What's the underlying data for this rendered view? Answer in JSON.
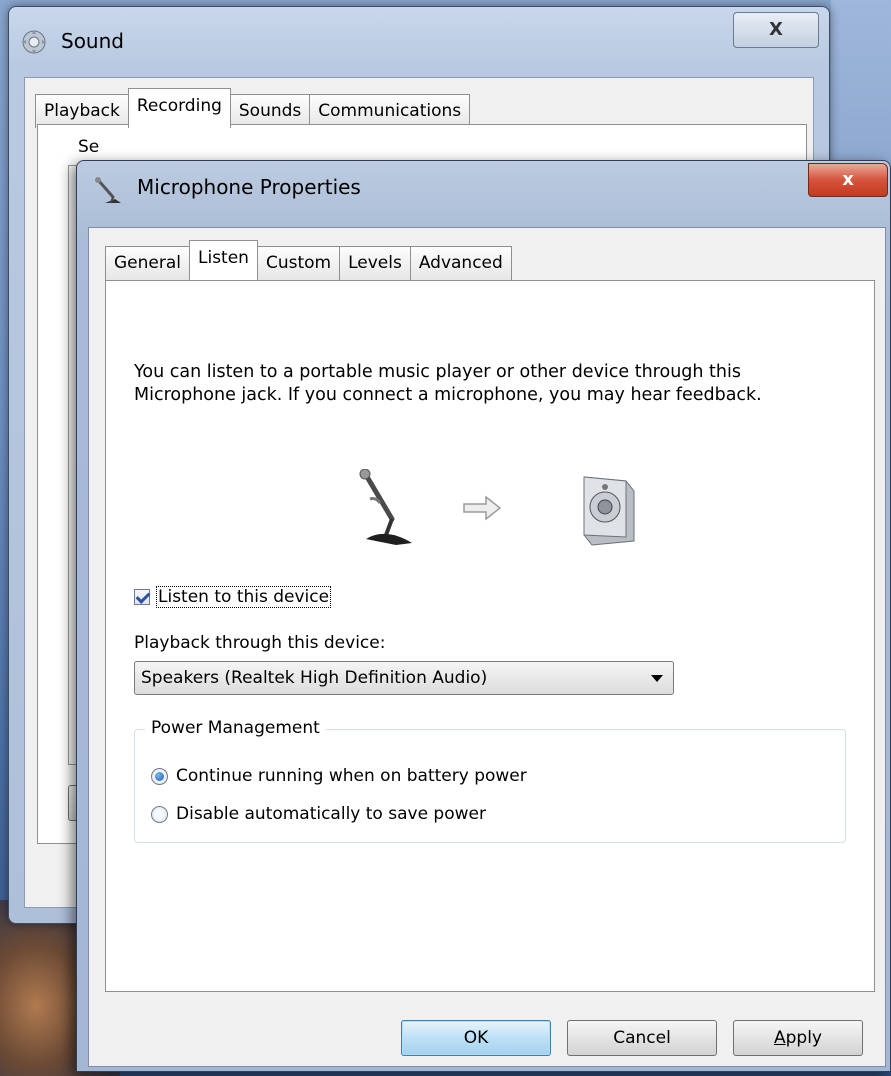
{
  "sound_window": {
    "title": "Sound",
    "close_glyph": "X",
    "tabs": [
      "Playback",
      "Recording",
      "Sounds",
      "Communications"
    ],
    "active_tab": "Recording",
    "hint_text": "Se"
  },
  "mic_window": {
    "title": "Microphone Properties",
    "close_glyph": "x",
    "tabs": [
      "General",
      "Listen",
      "Custom",
      "Levels",
      "Advanced"
    ],
    "active_tab": "Listen",
    "description": "You can listen to a portable music player or other device through this Microphone jack.  If you connect a microphone, you may hear feedback.",
    "listen_checkbox": {
      "label": "Listen to this device",
      "checked": true
    },
    "playback_label": "Playback through this device:",
    "playback_select": {
      "value": "Speakers (Realtek High Definition Audio)"
    },
    "power_group": {
      "legend": "Power Management",
      "options": [
        {
          "label": "Continue running when on battery power",
          "selected": true
        },
        {
          "label": "Disable automatically to save power",
          "selected": false
        }
      ]
    },
    "buttons": {
      "ok": "OK",
      "cancel": "Cancel",
      "apply_prefix": "A",
      "apply_rest": "pply"
    }
  },
  "icons": [
    "speaker-gear-icon",
    "microphone-icon",
    "right-arrow-icon",
    "speaker-icon",
    "dropdown-arrow-icon"
  ],
  "colors": {
    "accent": "#1e5fb8",
    "close_red": "#c23b22",
    "titlebar": "#a9bbd6"
  }
}
